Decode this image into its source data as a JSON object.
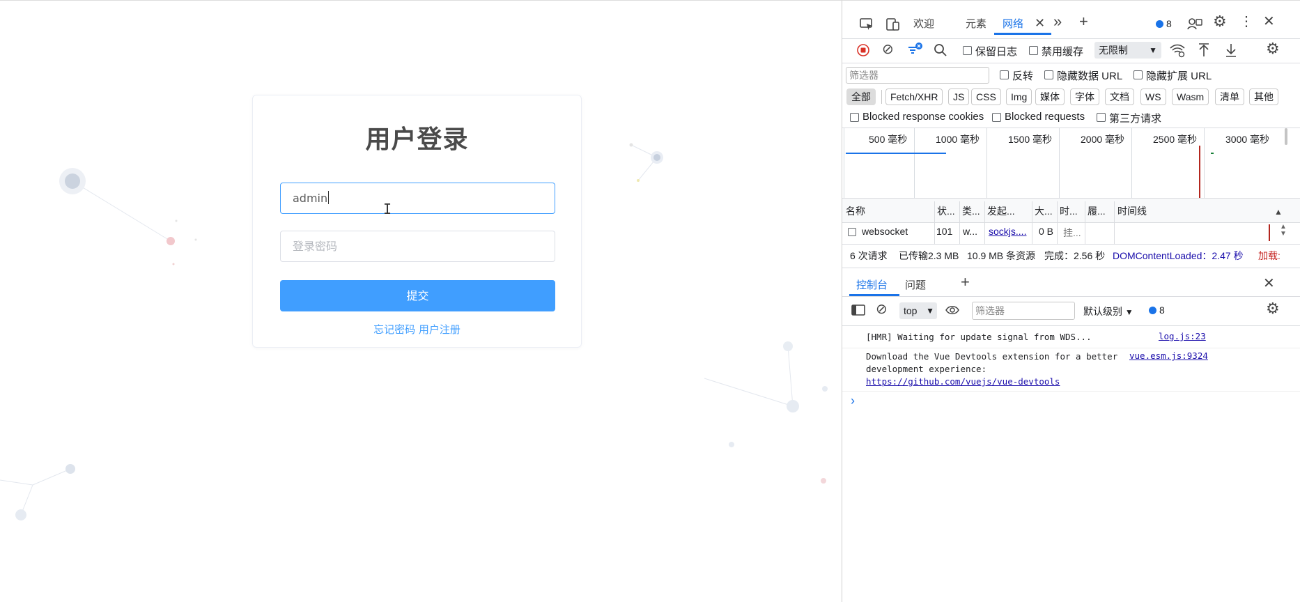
{
  "login": {
    "title": "用户登录",
    "username_value": "admin",
    "password_placeholder": "登录密码",
    "submit_label": "提交",
    "forgot_link": "忘记密码",
    "register_link": "用户注册"
  },
  "devtools": {
    "tabs": [
      "欢迎",
      "元素",
      "网络"
    ],
    "active_tab": "网络",
    "issues_count": "8",
    "toolbar": {
      "preserve_log": "保留日志",
      "disable_cache": "禁用缓存",
      "throttle": "无限制"
    },
    "filter": {
      "placeholder": "筛选器",
      "invert": "反转",
      "hide_data_url": "隐藏数据 URL",
      "hide_ext_url": "隐藏扩展 URL"
    },
    "type_chips": [
      "全部",
      "Fetch/XHR",
      "JS",
      "CSS",
      "Img",
      "媒体",
      "字体",
      "文档",
      "WS",
      "Wasm",
      "清单",
      "其他"
    ],
    "blocked": {
      "cookies": "Blocked response cookies",
      "requests": "Blocked requests",
      "third_party": "第三方请求"
    },
    "timeline_ticks": [
      "500  毫秒",
      "1000  毫秒",
      "1500  毫秒",
      "2000  毫秒",
      "2500  毫秒",
      "3000  毫秒"
    ],
    "columns": [
      "名称",
      "状...",
      "类...",
      "发起...",
      "大...",
      "时...",
      "履...",
      "时间线"
    ],
    "rows": [
      {
        "name": "websocket",
        "status": "101",
        "type": "w...",
        "initiator": "sockjs....",
        "size": "0 B",
        "time": "挂..."
      }
    ],
    "summary": {
      "requests": "6 次请求",
      "transferred": "已传输2.3 MB",
      "resources": "10.9 MB 条资源",
      "finish": "完成：2.56 秒",
      "dcl": "DOMContentLoaded：2.47 秒",
      "load": "加载:"
    },
    "drawer": {
      "tabs": [
        "控制台",
        "问题"
      ],
      "context": "top",
      "filter_placeholder": "筛选器",
      "level": "默认级别",
      "issues_count": "8",
      "messages": [
        {
          "text": "[HMR] Waiting for update signal from WDS...",
          "source": "log.js:23"
        },
        {
          "text": "Download the Vue Devtools extension for a better\ndevelopment experience:",
          "link": "https://github.com/vuejs/vue-devtools",
          "source": "vue.esm.js:9324"
        }
      ]
    }
  }
}
